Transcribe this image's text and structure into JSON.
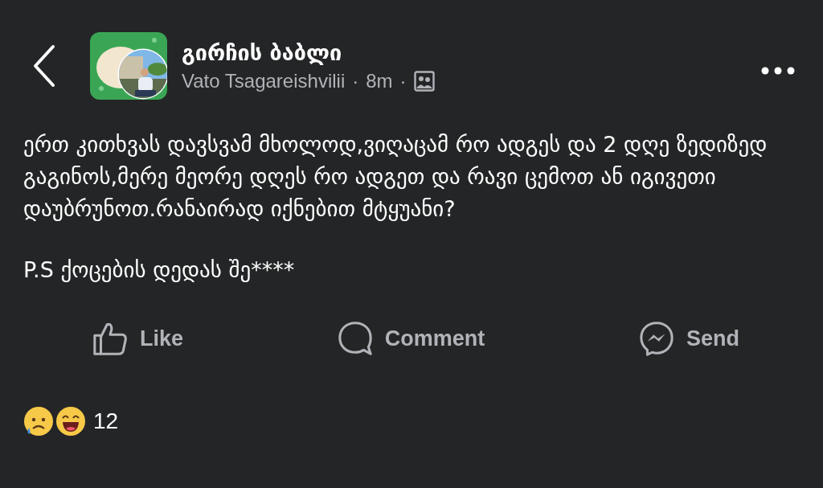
{
  "header": {
    "group_name": "გირჩის ბაბლი",
    "author": "Vato Tsagareishvilii",
    "time": "8m",
    "separator": "·"
  },
  "post": {
    "paragraphs": [
      "ერთ კითხვას დავსვამ მხოლოდ,ვიღაცამ რო ადგეს და 2 დღე ზედიზედ გაგინოს,მერე მეორე დღეს რო ადგეთ და რავი ცემოთ ან იგივეთი დაუბრუნოთ.რანაირად იქნებით მტყუანი?",
      "P.S ქოცების დედას შე****"
    ]
  },
  "actions": [
    {
      "kind": "like",
      "label": "Like"
    },
    {
      "kind": "comment",
      "label": "Comment"
    },
    {
      "kind": "send",
      "label": "Send"
    }
  ],
  "reactions": {
    "emojis": [
      {
        "kind": "sad"
      },
      {
        "kind": "haha"
      }
    ],
    "count": "12"
  }
}
